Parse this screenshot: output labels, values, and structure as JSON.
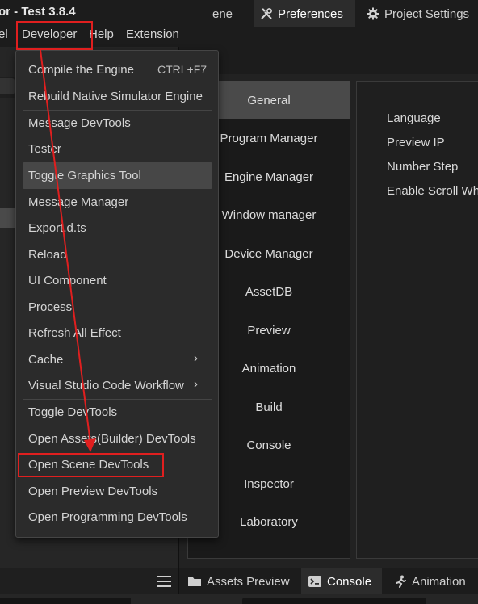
{
  "window": {
    "title": "or - Test 3.8.4"
  },
  "menubar": {
    "items": [
      {
        "label": "el"
      },
      {
        "label": "Developer"
      },
      {
        "label": "Help"
      },
      {
        "label": "Extension"
      }
    ]
  },
  "developer_menu": {
    "items": [
      {
        "label": "Compile the Engine",
        "shortcut": "CTRL+F7"
      },
      {
        "label": "Rebuild Native Simulator Engine"
      },
      {
        "label": "Message DevTools"
      },
      {
        "label": "Tester"
      },
      {
        "label": "Toggle Graphics Tool"
      },
      {
        "label": "Message Manager"
      },
      {
        "label": "Export.d.ts"
      },
      {
        "label": "Reload"
      },
      {
        "label": "UI Component"
      },
      {
        "label": "Process"
      },
      {
        "label": "Refresh All Effect"
      },
      {
        "label": "Cache",
        "submenu": true
      },
      {
        "label": "Visual Studio Code Workflow",
        "submenu": true
      },
      {
        "label": "Toggle DevTools"
      },
      {
        "label": "Open Assets(Builder) DevTools"
      },
      {
        "label": "Open Scene DevTools"
      },
      {
        "label": "Open Preview DevTools"
      },
      {
        "label": "Open Programming DevTools"
      }
    ],
    "submenu_arrow": "›"
  },
  "tabs": [
    {
      "label": "ene",
      "icon": ""
    },
    {
      "label": "Preferences",
      "icon": "tools-icon"
    },
    {
      "label": "Project Settings",
      "icon": "gear-icon"
    }
  ],
  "preferences": {
    "categories": [
      "General",
      "Program Manager",
      "Engine Manager",
      "Window manager",
      "Device Manager",
      "AssetDB",
      "Preview",
      "Animation",
      "Build",
      "Console",
      "Inspector",
      "Laboratory"
    ],
    "active_category": "General",
    "settings": [
      "Language",
      "Preview IP",
      "Number Step",
      "Enable Scroll Wh"
    ]
  },
  "bottom_tabs": [
    {
      "label": "Assets Preview",
      "icon": "folder-icon"
    },
    {
      "label": "Console",
      "icon": "console-icon"
    },
    {
      "label": "Animation",
      "icon": "running-icon"
    }
  ],
  "colors": {
    "background": "#1e1e1e",
    "menu_bg": "#2b2b2b",
    "highlight": "#e01f1f",
    "active_category": "#4a4a4a"
  }
}
